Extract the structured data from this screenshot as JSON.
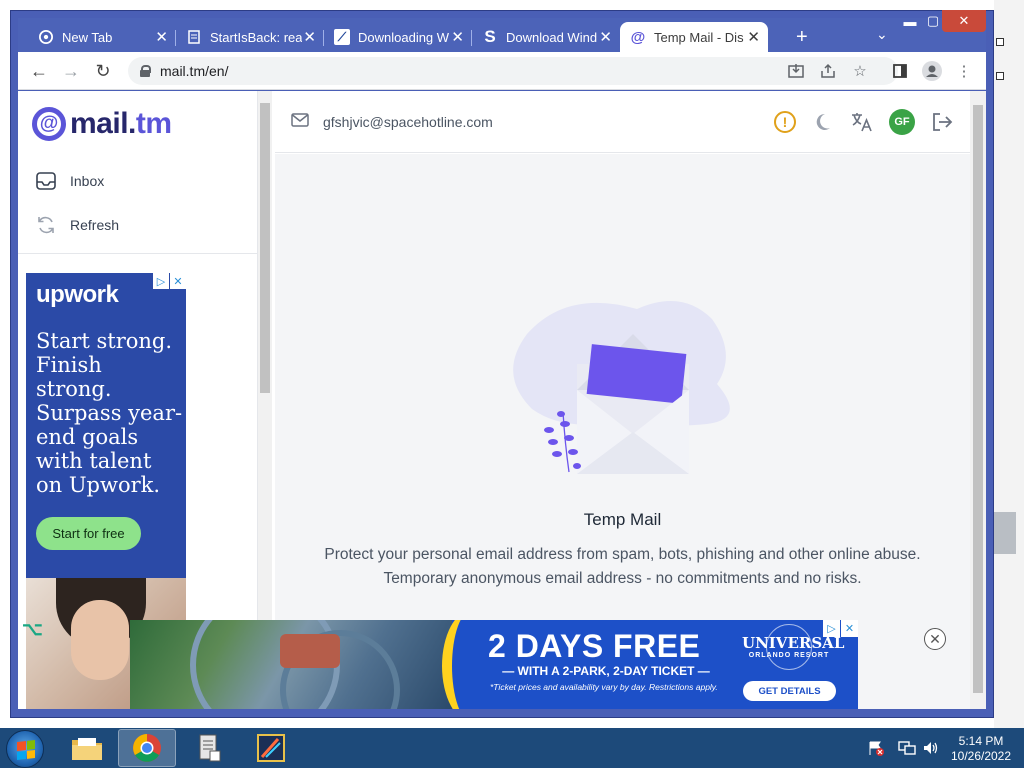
{
  "browser": {
    "tabs": [
      {
        "title": "New Tab",
        "icon": "chrome-icon",
        "active": false
      },
      {
        "title": "StartIsBack: rea",
        "icon": "document-icon",
        "active": false
      },
      {
        "title": "Downloading W",
        "icon": "download-site-icon",
        "active": false
      },
      {
        "title": "Download Wind",
        "icon": "s-logo-icon",
        "active": false
      },
      {
        "title": "Temp Mail - Dis",
        "icon": "at-icon",
        "active": true
      }
    ],
    "new_tab_symbol": "+",
    "tab_search_symbol": "⌄",
    "close_symbol": "✕",
    "window_controls": {
      "minimize": "▬",
      "maximize": "▢",
      "close": "✕"
    },
    "nav": {
      "back": "←",
      "forward": "→",
      "reload": "↻"
    },
    "url": "mail.tm/en/"
  },
  "sidebar": {
    "brand_prefix": "mail.",
    "brand_suffix": "tm",
    "items": [
      {
        "label": "Inbox",
        "icon": "inbox-icon"
      },
      {
        "label": "Refresh",
        "icon": "refresh-icon"
      }
    ]
  },
  "header": {
    "email_address": "gfshjvic@spacehotline.com",
    "avatar_initials": "GF",
    "warning_symbol": "!"
  },
  "main": {
    "title": "Temp Mail",
    "description": "Protect your personal email address from spam, bots, phishing and other online abuse. Temporary anonymous email address - no commitments and no risks."
  },
  "ads": {
    "side": {
      "brand": "upwork",
      "copy": "Start strong. Finish strong. Surpass year-end goals with talent on Upwork.",
      "cta": "Start for free"
    },
    "bottom": {
      "headline": "2 DAYS FREE",
      "subline": "— WITH A 2-PARK, 2-DAY TICKET —",
      "fine_print": "*Ticket prices and availability vary by day. Restrictions apply.",
      "brand": "UNIVERSAL",
      "brand_sub": "ORLANDO RESORT",
      "cta": "GET DETAILS"
    },
    "badge_play": "▷",
    "badge_close": "✕"
  },
  "taskbar": {
    "time": "5:14 PM",
    "date": "10/26/2022"
  },
  "colors": {
    "accent": "#5b55d8",
    "brand_dark": "#27276b",
    "tab_strip": "#4c63b8",
    "upwork_bg": "#2b4aa7",
    "universal_bg": "#1d50c8",
    "warning": "#e0a11b",
    "avatar_bg": "#3aa346"
  }
}
